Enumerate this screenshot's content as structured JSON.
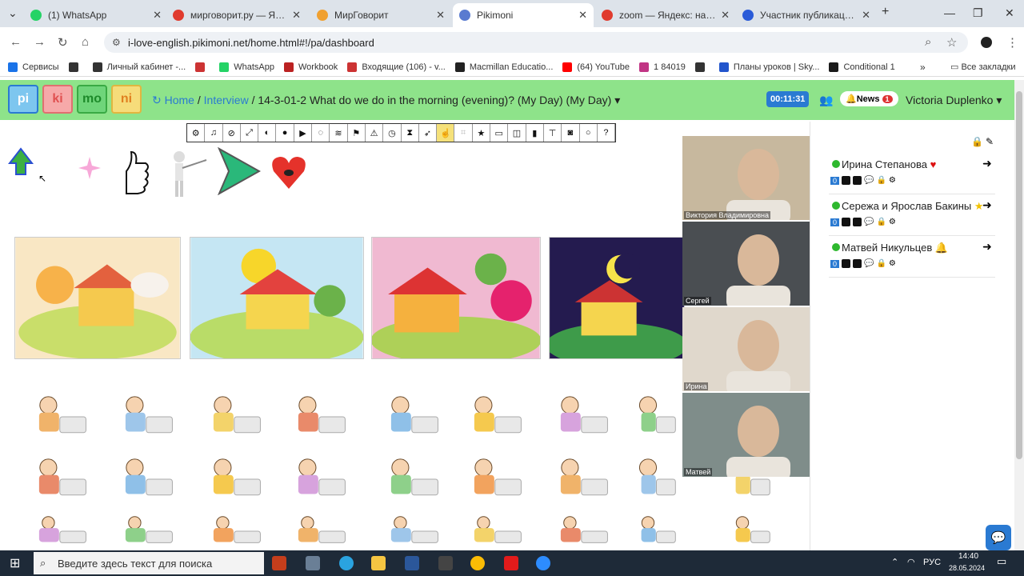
{
  "browser": {
    "tabs": [
      {
        "label": "(1) WhatsApp",
        "color": "#25d366"
      },
      {
        "label": "мирговорит.ру — Яндекс",
        "color": "#e03b2e"
      },
      {
        "label": "МирГоворит",
        "color": "#f0a030"
      },
      {
        "label": "Pikimoni",
        "color": "#5a7bd0",
        "active": true
      },
      {
        "label": "zoom — Яндекс: нашлось",
        "color": "#e03b2e"
      },
      {
        "label": "Участник публикации - Z",
        "color": "#2a5bd8"
      }
    ],
    "url": "i-love-english.pikimoni.net/home.html#!/pa/dashboard",
    "bookmarks": [
      {
        "label": "Сервисы"
      },
      {
        "label": ""
      },
      {
        "label": "Личный кабинет -..."
      },
      {
        "label": ""
      },
      {
        "label": "WhatsApp"
      },
      {
        "label": "Workbook"
      },
      {
        "label": "Входящие (106) - v..."
      },
      {
        "label": "Macmillan Educatio..."
      },
      {
        "label": "(64) YouTube"
      },
      {
        "label": "1 84019"
      },
      {
        "label": ""
      },
      {
        "label": "Планы уроков | Sky..."
      },
      {
        "label": "Conditional 1"
      }
    ],
    "all_bookmarks": "Все закладки"
  },
  "site": {
    "buttons": [
      "pi",
      "ki",
      "mo",
      "ni"
    ],
    "home": "Home",
    "interview": "Interview",
    "title": "/ 14-3-01-2 What do we do in the morning (evening)? (My Day) (My Day)",
    "timer": "00:11:31",
    "news": "News",
    "news_count": "1",
    "user": "Victoria Duplenko"
  },
  "participants": [
    {
      "name": "Ирина Степанова",
      "mark": "♥",
      "markcolor": "#d11"
    },
    {
      "name": "Сережа и Ярослав Бакины",
      "mark": "★",
      "markcolor": "#f2c200"
    },
    {
      "name": "Матвей Никульцев",
      "mark": "🔔",
      "markcolor": "#8a2be2"
    }
  ],
  "participant_counts": [
    "0",
    "0",
    "0"
  ],
  "videos": [
    {
      "name": "Виктория Владимировна"
    },
    {
      "name": "Сергей"
    },
    {
      "name": "Ирина"
    },
    {
      "name": "Матвей"
    }
  ],
  "taskbar": {
    "search_placeholder": "Введите здесь текст для поиска",
    "lang": "РУС",
    "time": "14:40",
    "date": "28.05.2024"
  }
}
